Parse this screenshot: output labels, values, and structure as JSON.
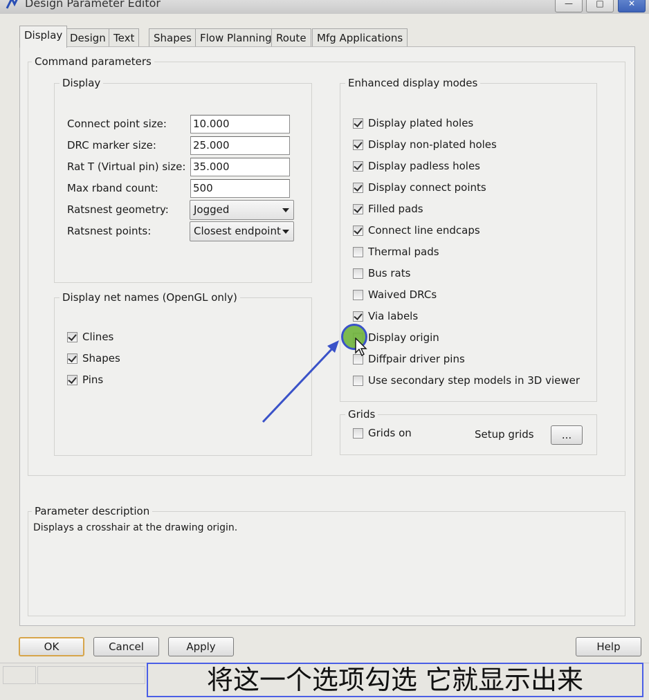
{
  "window": {
    "title": "Design Parameter Editor",
    "min_glyph": "—",
    "max_glyph": "□",
    "close_glyph": "✕"
  },
  "tabs": [
    "Display",
    "Design",
    "Text",
    "Shapes",
    "Flow Planning",
    "Route",
    "Mfg Applications"
  ],
  "active_tab": "Display",
  "command_parameters": {
    "title": "Command parameters",
    "display_group": {
      "title": "Display",
      "fields": [
        {
          "label": "Connect point size:",
          "value": "10.000"
        },
        {
          "label": "DRC marker size:",
          "value": "25.000"
        },
        {
          "label": "Rat T (Virtual pin) size:",
          "value": "35.000"
        },
        {
          "label": "Max rband count:",
          "value": "500"
        }
      ],
      "dropdowns": [
        {
          "label": "Ratsnest geometry:",
          "value": "Jogged"
        },
        {
          "label": "Ratsnest points:",
          "value": "Closest endpoint"
        }
      ]
    },
    "net_names_group": {
      "title": "Display net names (OpenGL only)",
      "items": [
        {
          "label": "Clines",
          "checked": true
        },
        {
          "label": "Shapes",
          "checked": true
        },
        {
          "label": "Pins",
          "checked": true
        }
      ]
    },
    "enhanced_group": {
      "title": "Enhanced display modes",
      "items": [
        {
          "label": "Display plated holes",
          "checked": true
        },
        {
          "label": "Display non-plated holes",
          "checked": true
        },
        {
          "label": "Display padless holes",
          "checked": true
        },
        {
          "label": "Display connect points",
          "checked": true
        },
        {
          "label": "Filled pads",
          "checked": true
        },
        {
          "label": "Connect line endcaps",
          "checked": true
        },
        {
          "label": "Thermal pads",
          "checked": false
        },
        {
          "label": "Bus rats",
          "checked": false
        },
        {
          "label": "Waived DRCs",
          "checked": false
        },
        {
          "label": "Via labels",
          "checked": true
        },
        {
          "label": "Display origin",
          "checked": false
        },
        {
          "label": "Diffpair driver pins",
          "checked": false
        },
        {
          "label": "Use secondary step models in 3D viewer",
          "checked": false
        }
      ]
    },
    "grids_group": {
      "title": "Grids",
      "grids_on_label": "Grids on",
      "grids_on_checked": false,
      "setup_label": "Setup grids",
      "setup_button": "..."
    }
  },
  "parameter_description": {
    "title": "Parameter description",
    "text": "Displays a crosshair at the drawing origin."
  },
  "buttons": {
    "ok": "OK",
    "cancel": "Cancel",
    "apply": "Apply",
    "help": "Help"
  },
  "caption": "将这一个选项勾选 它就显示出来",
  "colors": {
    "annotation": "#3a52c8",
    "cursor_highlight": "#70b43c",
    "default_button_border": "#d7a54a"
  }
}
